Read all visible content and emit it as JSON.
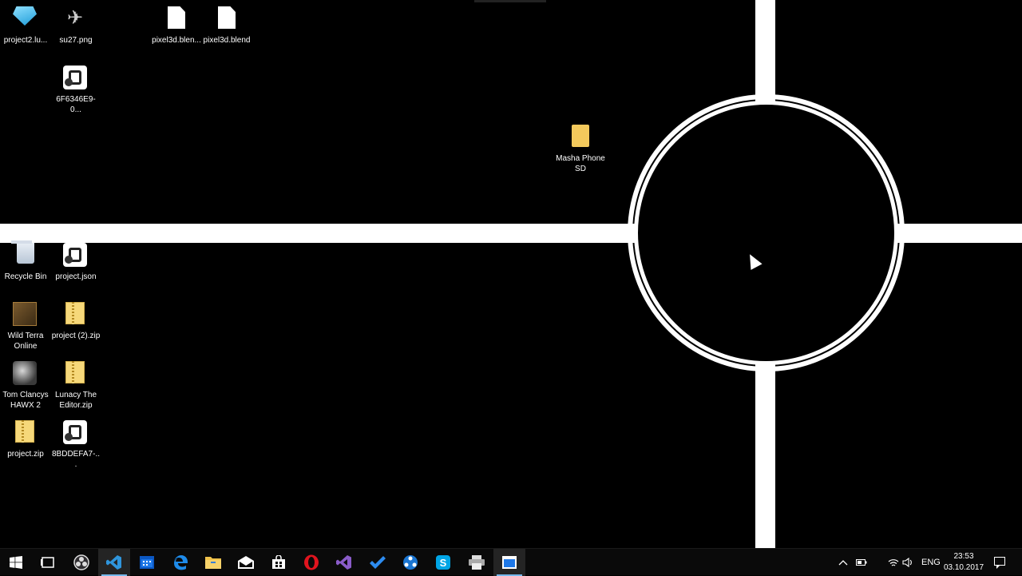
{
  "desktop": {
    "icons": [
      {
        "label": "project2.lu...",
        "icon": "cube-app-icon"
      },
      {
        "label": "su27.png",
        "icon": "jet-image-icon"
      },
      {
        "label": "pixel3d.blen...",
        "icon": "document-icon"
      },
      {
        "label": "pixel3d.blend",
        "icon": "document-icon"
      },
      {
        "label": "6F6346E9-0...",
        "icon": "script-icon"
      },
      {
        "label": "Masha Phone SD",
        "icon": "folder-icon"
      },
      {
        "label": "Recycle Bin",
        "icon": "recycle-bin-icon"
      },
      {
        "label": "project.json",
        "icon": "script-icon"
      },
      {
        "label": "Wild Terra Online",
        "icon": "game-shortcut-icon"
      },
      {
        "label": "project (2).zip",
        "icon": "zip-folder-icon"
      },
      {
        "label": "Tom Clancys HAWX 2",
        "icon": "game-shortcut-icon"
      },
      {
        "label": "Lunacy The Editor.zip",
        "icon": "zip-folder-icon"
      },
      {
        "label": "project.zip",
        "icon": "zip-folder-icon"
      },
      {
        "label": "8BDDEFA7-...",
        "icon": "script-icon"
      }
    ]
  },
  "taskbar": {
    "buttons": [
      {
        "name": "start-button",
        "icon": "windows-icon"
      },
      {
        "name": "task-view-button",
        "icon": "task-view-icon"
      },
      {
        "name": "obs-button",
        "icon": "obs-icon"
      },
      {
        "name": "vscode-button",
        "icon": "vscode-icon"
      },
      {
        "name": "calendar-app-button",
        "icon": "calendar-icon"
      },
      {
        "name": "edge-button",
        "icon": "edge-icon"
      },
      {
        "name": "file-explorer-button",
        "icon": "folder-icon"
      },
      {
        "name": "mail-button",
        "icon": "mail-icon"
      },
      {
        "name": "store-button",
        "icon": "store-icon"
      },
      {
        "name": "opera-button",
        "icon": "opera-icon"
      },
      {
        "name": "visual-studio-button",
        "icon": "visual-studio-icon"
      },
      {
        "name": "todo-button",
        "icon": "checkmark-icon"
      },
      {
        "name": "network-app-button",
        "icon": "network-icon"
      },
      {
        "name": "skype-button",
        "icon": "skype-icon"
      },
      {
        "name": "printer-app-button",
        "icon": "printer-icon"
      },
      {
        "name": "active-window-button",
        "icon": "window-icon"
      }
    ],
    "tray": {
      "language": "ENG",
      "time": "23:53",
      "date": "03.10.2017"
    },
    "colors": {
      "accent": "#76b9ed",
      "background": "#0a0a0a"
    }
  }
}
